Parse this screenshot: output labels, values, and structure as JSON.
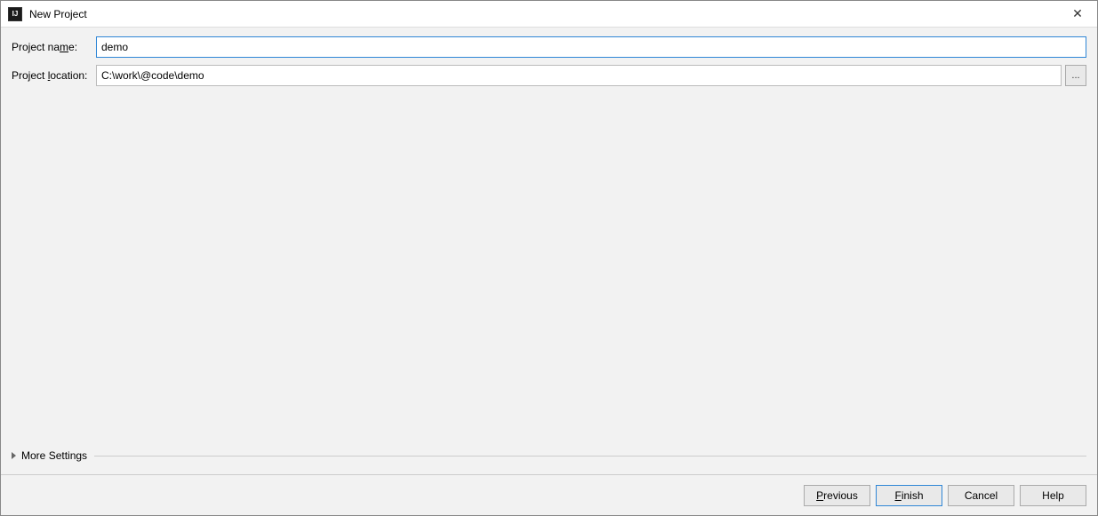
{
  "titlebar": {
    "icon_text": "IJ",
    "title": "New Project",
    "close_label": "✕"
  },
  "form": {
    "name_label_pre": "Project na",
    "name_label_m": "m",
    "name_label_post": "e:",
    "name_value": "demo",
    "location_label_pre": "Project ",
    "location_label_m": "l",
    "location_label_post": "ocation:",
    "location_value": "C:\\work\\@code\\demo",
    "browse_label": "..."
  },
  "more_settings": {
    "label_pre": "Mor",
    "label_m": "e",
    "label_post": " Settings"
  },
  "buttons": {
    "previous_m": "P",
    "previous_post": "revious",
    "finish_m": "F",
    "finish_post": "inish",
    "cancel": "Cancel",
    "help": "Help"
  }
}
